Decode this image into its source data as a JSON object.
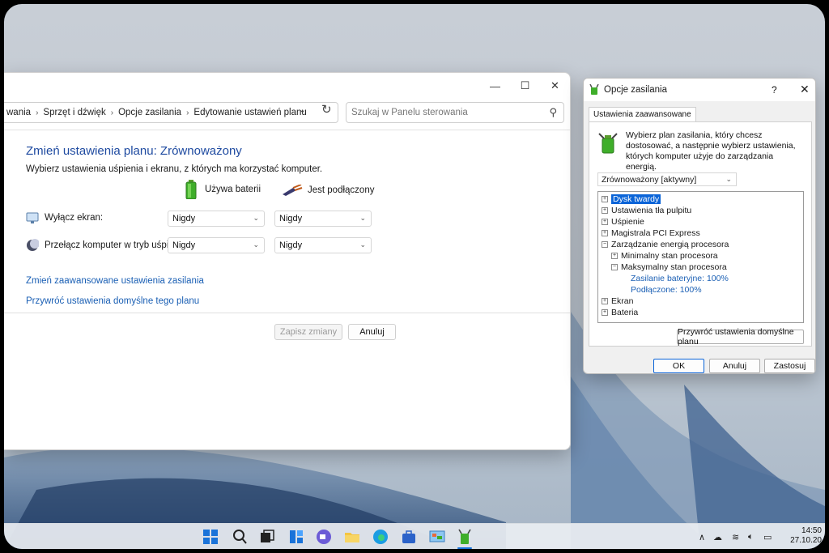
{
  "main_window": {
    "breadcrumb": [
      "wania",
      "Sprzęt i dźwięk",
      "Opcje zasilania",
      "Edytowanie ustawień planu"
    ],
    "search_placeholder": "Szukaj w Panelu sterowania",
    "title": "Zmień ustawienia planu: Zrównoważony",
    "subtitle": "Wybierz ustawienia uśpienia i ekranu, z których ma korzystać komputer.",
    "col_battery": "Używa baterii",
    "col_plugged": "Jest podłączony",
    "rows": [
      {
        "label": "Wyłącz ekran:",
        "battery": "Nigdy",
        "plugged": "Nigdy"
      },
      {
        "label": "Przełącz komputer w tryb uśpienia:",
        "battery": "Nigdy",
        "plugged": "Nigdy"
      }
    ],
    "link_advanced": "Zmień zaawansowane ustawienia zasilania",
    "link_restore": "Przywróć ustawienia domyślne tego planu",
    "btn_save": "Zapisz zmiany",
    "btn_cancel": "Anuluj"
  },
  "dialog": {
    "title": "Opcje zasilania",
    "help": "?",
    "close": "✕",
    "tab": "Ustawienia zaawansowane",
    "desc": "Wybierz plan zasilania, który chcesz dostosować, a następnie wybierz ustawienia, których komputer użyje do zarządzania energią.",
    "plan": "Zrównoważony [aktywny]",
    "tree": {
      "n0": "Dysk twardy",
      "n1": "Ustawienia tła pulpitu",
      "n2": "Uśpienie",
      "n3": "Magistrala PCI Express",
      "n4": "Zarządzanie energią procesora",
      "n4a": "Minimalny stan procesora",
      "n4b": "Maksymalny stan procesora",
      "n4b1": "Zasilanie bateryjne: 100%",
      "n4b2": "Podłączone: 100%",
      "n5": "Ekran",
      "n6": "Bateria"
    },
    "btn_restore": "Przywróć ustawienia domyślne planu",
    "btn_ok": "OK",
    "btn_cancel": "Anuluj",
    "btn_apply": "Zastosuj"
  },
  "taskbar": {
    "time": "14:50",
    "date": "27.10.20"
  },
  "colors": {
    "accent": "#0a64d8",
    "link": "#1a5fb4",
    "title_blue": "#1e4aa0"
  }
}
